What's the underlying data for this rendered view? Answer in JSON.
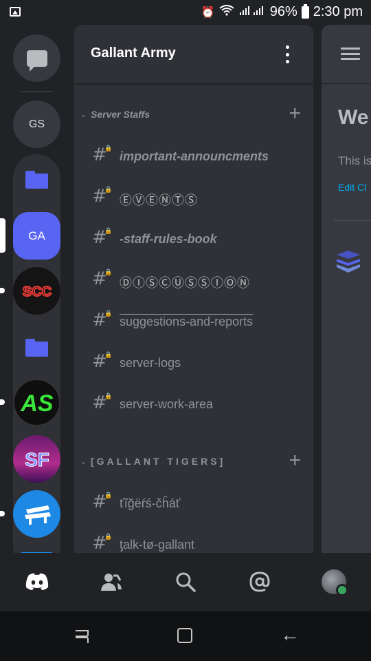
{
  "status_bar": {
    "battery": "96%",
    "time": "2:30 pm"
  },
  "servers": [
    {
      "initials": "GS"
    },
    {
      "initials": "GA"
    }
  ],
  "server_icons": {
    "scc": "SCC",
    "as": "AS",
    "sf": "SF"
  },
  "server": {
    "name": "Gallant Army"
  },
  "categories": [
    {
      "name": "Server Staffs",
      "channels": [
        "important-announcments",
        "ⒺⓋⒺⓃⓉⓈ",
        "-staff-rules-book",
        "ⒹⒾⓈⒸⓊⓈⓈⒾⓄⓃ",
        "suggestions-and-reports",
        "server-logs",
        "server-work-area"
      ]
    },
    {
      "name": "[GALLANT TIGERS]",
      "channels": [
        "ťĩğëŕś-čĥáť",
        "ƫalk-tø-gallant"
      ]
    }
  ],
  "peek": {
    "welcome": "We",
    "description": "This is",
    "edit": "Edit Cl"
  },
  "colors": {
    "background": "#202225",
    "panel": "#2f3136",
    "chat": "#36393f",
    "blurple": "#5865f2",
    "muted": "#8e9297",
    "online": "#3ba55d",
    "link": "#00aff4"
  },
  "bottom_nav": [
    "discord-home-icon",
    "friends-icon",
    "search-icon",
    "mentions-icon",
    "profile-avatar"
  ]
}
